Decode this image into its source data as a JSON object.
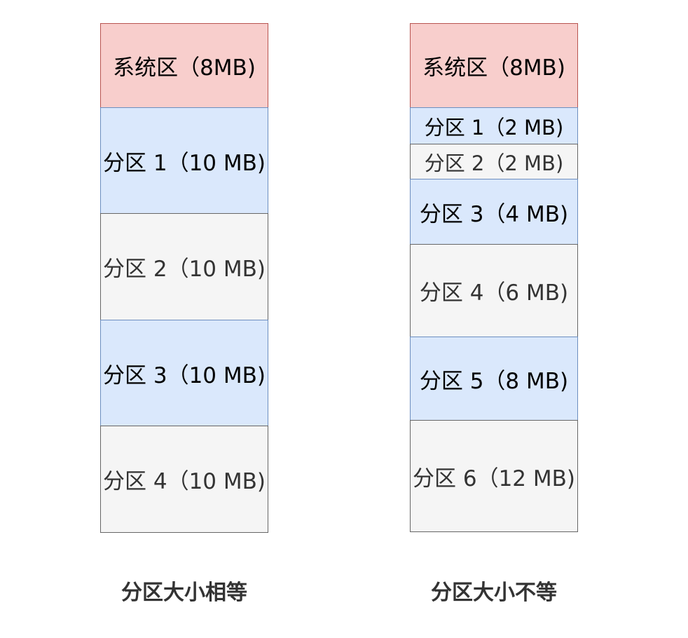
{
  "colors": {
    "system": {
      "fill": "#f8cecc",
      "stroke": "#b85450"
    },
    "blue": {
      "fill": "#dae8fc",
      "stroke": "#6c8ebf"
    },
    "gray": {
      "fill": "#f5f5f5",
      "stroke": "#666666"
    },
    "text_dark": "#000000",
    "text_gray": "#333333"
  },
  "left": {
    "caption": "分区大小相等",
    "blocks": [
      {
        "label": "系统区（8MB)",
        "style": "system"
      },
      {
        "label": "分区 1（10 MB)",
        "style": "blue"
      },
      {
        "label": "分区 2（10 MB)",
        "style": "gray"
      },
      {
        "label": "分区 3（10 MB)",
        "style": "blue"
      },
      {
        "label": "分区 4（10 MB)",
        "style": "gray"
      }
    ]
  },
  "right": {
    "caption": "分区大小不等",
    "blocks": [
      {
        "label": "系统区（8MB)",
        "style": "system"
      },
      {
        "label": "分区 1（2 MB)",
        "style": "blue"
      },
      {
        "label": "分区 2（2 MB)",
        "style": "gray"
      },
      {
        "label": "分区 3（4 MB)",
        "style": "blue"
      },
      {
        "label": "分区 4（6 MB)",
        "style": "gray"
      },
      {
        "label": "分区 5（8 MB)",
        "style": "blue"
      },
      {
        "label": "分区 6（12 MB)",
        "style": "gray"
      }
    ]
  }
}
